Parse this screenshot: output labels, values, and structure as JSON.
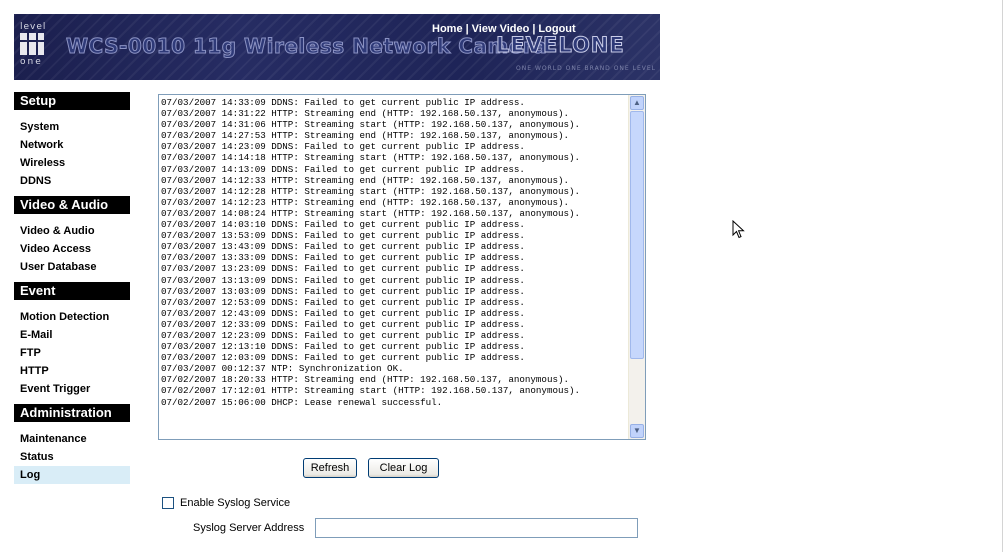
{
  "banner": {
    "logo_top": "level",
    "logo_bottom": "one",
    "product_title": "WCS-0010 11g Wireless Network Camera",
    "brand": "LEVELONE",
    "slogan": "ONE WORLD ONE BRAND ONE LEVEL",
    "links": [
      "Home",
      "View Video",
      "Logout"
    ],
    "separator": "|"
  },
  "sidebar": {
    "sections": [
      {
        "title": "Setup",
        "items": [
          "System",
          "Network",
          "Wireless",
          "DDNS"
        ]
      },
      {
        "title": "Video & Audio",
        "items": [
          "Video & Audio",
          "Video Access",
          "User Database"
        ]
      },
      {
        "title": "Event",
        "items": [
          "Motion Detection",
          "E-Mail",
          "FTP",
          "HTTP",
          "Event Trigger"
        ]
      },
      {
        "title": "Administration",
        "items": [
          "Maintenance",
          "Status",
          "Log"
        ]
      }
    ],
    "active_item": "Log"
  },
  "log": {
    "lines": [
      "07/03/2007 14:33:09 DDNS: Failed to get current public IP address.",
      "07/03/2007 14:31:22 HTTP: Streaming end (HTTP: 192.168.50.137, anonymous).",
      "07/03/2007 14:31:06 HTTP: Streaming start (HTTP: 192.168.50.137, anonymous).",
      "07/03/2007 14:27:53 HTTP: Streaming end (HTTP: 192.168.50.137, anonymous).",
      "07/03/2007 14:23:09 DDNS: Failed to get current public IP address.",
      "07/03/2007 14:14:18 HTTP: Streaming start (HTTP: 192.168.50.137, anonymous).",
      "07/03/2007 14:13:09 DDNS: Failed to get current public IP address.",
      "07/03/2007 14:12:33 HTTP: Streaming end (HTTP: 192.168.50.137, anonymous).",
      "07/03/2007 14:12:28 HTTP: Streaming start (HTTP: 192.168.50.137, anonymous).",
      "07/03/2007 14:12:23 HTTP: Streaming end (HTTP: 192.168.50.137, anonymous).",
      "07/03/2007 14:08:24 HTTP: Streaming start (HTTP: 192.168.50.137, anonymous).",
      "07/03/2007 14:03:10 DDNS: Failed to get current public IP address.",
      "07/03/2007 13:53:09 DDNS: Failed to get current public IP address.",
      "07/03/2007 13:43:09 DDNS: Failed to get current public IP address.",
      "07/03/2007 13:33:09 DDNS: Failed to get current public IP address.",
      "07/03/2007 13:23:09 DDNS: Failed to get current public IP address.",
      "07/03/2007 13:13:09 DDNS: Failed to get current public IP address.",
      "07/03/2007 13:03:09 DDNS: Failed to get current public IP address.",
      "07/03/2007 12:53:09 DDNS: Failed to get current public IP address.",
      "07/03/2007 12:43:09 DDNS: Failed to get current public IP address.",
      "07/03/2007 12:33:09 DDNS: Failed to get current public IP address.",
      "07/03/2007 12:23:09 DDNS: Failed to get current public IP address.",
      "07/03/2007 12:13:10 DDNS: Failed to get current public IP address.",
      "07/03/2007 12:03:09 DDNS: Failed to get current public IP address.",
      "07/03/2007 00:12:37 NTP: Synchronization OK.",
      "07/02/2007 18:20:33 HTTP: Streaming end (HTTP: 192.168.50.137, anonymous).",
      "07/02/2007 17:12:01 HTTP: Streaming start (HTTP: 192.168.50.137, anonymous).",
      "07/02/2007 15:06:00 DHCP: Lease renewal successful."
    ]
  },
  "buttons": {
    "refresh": "Refresh",
    "clear_log": "Clear Log"
  },
  "syslog": {
    "enable_label": "Enable Syslog Service",
    "enabled": false,
    "server_label": "Syslog Server Address",
    "server_value": ""
  }
}
